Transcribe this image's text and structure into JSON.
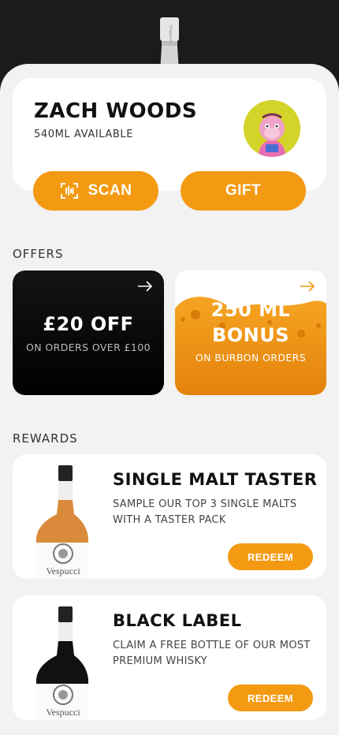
{
  "profile": {
    "name": "ZACH WOODS",
    "available": "540ML AVAILABLE",
    "avatar_icon": "ape-avatar"
  },
  "actions": {
    "scan_label": "SCAN",
    "scan_icon": "scan-icon",
    "gift_label": "GIFT"
  },
  "offers": {
    "section_title": "OFFERS",
    "items": [
      {
        "title": "£20 OFF",
        "subtitle": "ON ORDERS OVER £100",
        "theme": "dark"
      },
      {
        "title_line1": "250 ML",
        "title_line2": "BONUS",
        "subtitle": "ON BURBON ORDERS",
        "theme": "orange"
      }
    ]
  },
  "rewards": {
    "section_title": "REWARDS",
    "items": [
      {
        "title": "SINGLE MALT TASTER",
        "description": "SAMPLE OUR TOP 3 SINGLE MALTS WITH A TASTER PACK",
        "button": "REDEEM",
        "bottle_color": "#d98a3a",
        "brand": "Vespucci"
      },
      {
        "title": "BLACK LABEL",
        "description": "CLAIM A FREE BOTTLE OF OUR MOST PREMIUM WHISKY",
        "button": "REDEEM",
        "bottle_color": "#111111",
        "brand": "Vespucci"
      }
    ]
  },
  "colors": {
    "accent": "#f49a12",
    "background": "#f2f2f2",
    "card": "#ffffff",
    "dark": "#000000"
  }
}
